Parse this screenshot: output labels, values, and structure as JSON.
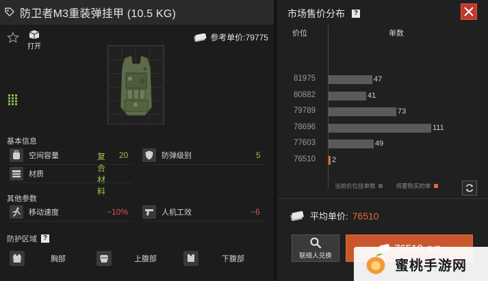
{
  "item": {
    "title": "防卫者M3重装弹挂甲 (10.5 KG)",
    "open_label": "打开",
    "ref_price_label": "参考单价:79775"
  },
  "basic_info": {
    "heading": "基本信息",
    "capacity_label": "空间容量",
    "capacity_value": "20",
    "armor_label": "防弹级别",
    "armor_value": "5",
    "material_label": "材质",
    "material_value": "复合材料"
  },
  "other_params": {
    "heading": "其他参数",
    "speed_label": "移动速度",
    "speed_value": "−10%",
    "ergonomics_label": "人机工效",
    "ergonomics_value": "−6"
  },
  "protection": {
    "heading": "防护区域",
    "help": "?",
    "zones": [
      "胸部",
      "上腹部",
      "下腹部"
    ]
  },
  "market": {
    "title": "市场售价分布",
    "help": "?",
    "col_price": "价位",
    "col_count": "单数",
    "legend_current": "当前价位挂单数",
    "legend_mine": "将要购买的单",
    "avg_label": "平均单价:",
    "avg_value": "76510",
    "contact_label": "联络人兑换",
    "buy_price": "76510",
    "buy_label": "购买"
  },
  "chart_data": {
    "type": "bar",
    "orientation": "horizontal",
    "categories": [
      "81975",
      "80882",
      "79789",
      "78696",
      "77603",
      "76510"
    ],
    "values": [
      47,
      41,
      73,
      111,
      49,
      2
    ],
    "highlight_category": "76510",
    "colors": {
      "current": "#5a5a5a",
      "mine": "#e06a40"
    }
  },
  "watermark": {
    "text": "蜜桃手游网"
  },
  "colors": {
    "accent": "#e06a40",
    "positive": "#9bc24b",
    "negative": "#d9534f",
    "close": "#c0392b"
  }
}
